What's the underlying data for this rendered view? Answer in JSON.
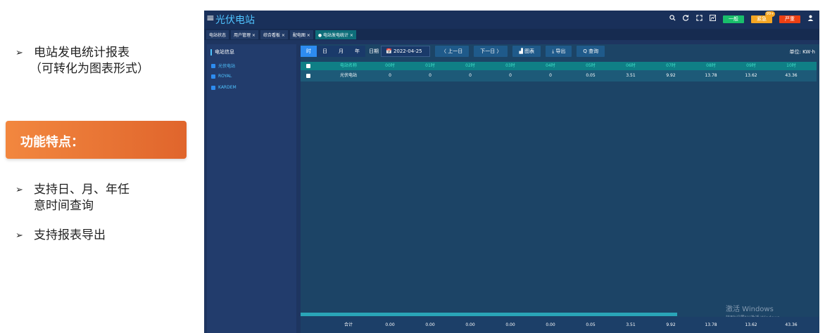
{
  "slide": {
    "bullet1_line1": "电站发电统计报表",
    "bullet1_line2": "（可转化为图表形式）",
    "feature_title": "功能特点：",
    "bullet2_line1": "支持日、月、年任",
    "bullet2_line2": "意时间查询",
    "bullet3": "支持报表导出",
    "arrow": "➢"
  },
  "app": {
    "title": "光伏电站",
    "menu_icon": "≡",
    "top_icons": [
      "search-icon",
      "refresh-icon",
      "fullscreen-icon",
      "screen-icon"
    ],
    "badges": [
      {
        "label": "一般",
        "color": "#19be6b"
      },
      {
        "label": "紧急",
        "color": "#f5a623",
        "dot": "99+"
      },
      {
        "label": "严重",
        "color": "#ed4014"
      }
    ],
    "user_icon": "user-icon"
  },
  "tabs": [
    {
      "label": "电站状态"
    },
    {
      "label": "用户管理 ×"
    },
    {
      "label": "综合看板 ×"
    },
    {
      "label": "配电图 ×"
    },
    {
      "label": "● 电站发电统计 ×",
      "active": true
    }
  ],
  "sidebar": {
    "title": "电站信息",
    "items": [
      "光伏电站",
      "ROYAL",
      "KARDEM"
    ]
  },
  "toolbar": {
    "periods": [
      "时",
      "日",
      "月",
      "年"
    ],
    "active_period": "时",
    "date_label": "日期",
    "date_value": "📅 2022-04-25",
    "prev": "〈 上一日",
    "next": "下一日 〉",
    "chart": "▟ 图表",
    "export": "⤓ 导出",
    "query": "Q 查询",
    "unit": "单位: KW·h"
  },
  "table": {
    "columns": [
      "电站名称",
      "00时",
      "01时",
      "02时",
      "03时",
      "04时",
      "05时",
      "06时",
      "07时",
      "08时",
      "09时",
      "10时"
    ],
    "rows": [
      [
        "光伏电站",
        "0",
        "0",
        "0",
        "0",
        "0",
        "0.05",
        "3.51",
        "9.92",
        "13.78",
        "13.62",
        "43.36"
      ]
    ],
    "footer": [
      "合计",
      "0.00",
      "0.00",
      "0.00",
      "0.00",
      "0.00",
      "0.05",
      "3.51",
      "9.92",
      "13.78",
      "13.62",
      "43.36"
    ]
  },
  "watermark": {
    "line1": "激活 Windows",
    "line2": "转到\"设置\"以激活 Windows。"
  }
}
